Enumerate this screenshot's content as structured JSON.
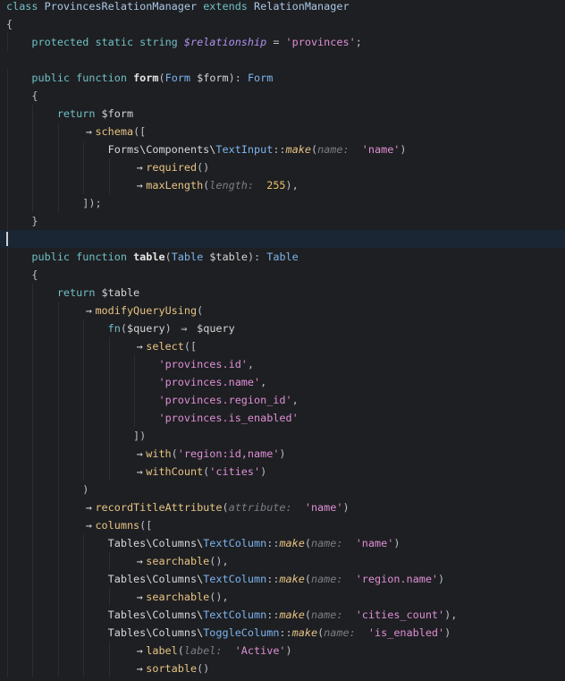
{
  "editor": {
    "current_line": 13,
    "lines": [
      {
        "indent": 0,
        "tokens": [
          [
            "kw",
            "class "
          ],
          [
            "cls",
            "ProvincesRelationManager "
          ],
          [
            "kw",
            "extends "
          ],
          [
            "cls",
            "RelationManager"
          ]
        ]
      },
      {
        "indent": 0,
        "tokens": [
          [
            "punct",
            "{"
          ]
        ]
      },
      {
        "indent": 4,
        "tokens": [
          [
            "kw",
            "protected static string "
          ],
          [
            "ivar",
            "$relationship"
          ],
          [
            "punct",
            " = "
          ],
          [
            "str",
            "'provinces'"
          ],
          [
            "punct",
            ";"
          ]
        ]
      },
      {
        "indent": 0,
        "tokens": []
      },
      {
        "indent": 4,
        "tokens": [
          [
            "kw",
            "public function "
          ],
          [
            "fn",
            "form"
          ],
          [
            "punct",
            "("
          ],
          [
            "type",
            "Form "
          ],
          [
            "var",
            "$form"
          ],
          [
            "punct",
            "): "
          ],
          [
            "type",
            "Form"
          ]
        ]
      },
      {
        "indent": 4,
        "tokens": [
          [
            "punct",
            "{"
          ]
        ]
      },
      {
        "indent": 8,
        "tokens": [
          [
            "kw",
            "return "
          ],
          [
            "var",
            "$form"
          ]
        ]
      },
      {
        "indent": 12,
        "tokens": [
          [
            "op",
            "→"
          ],
          [
            "method",
            "schema"
          ],
          [
            "punct",
            "(["
          ]
        ]
      },
      {
        "indent": 16,
        "tokens": [
          [
            "ns",
            "Forms\\Components\\"
          ],
          [
            "type",
            "TextInput"
          ],
          [
            "punct",
            "::"
          ],
          [
            "static",
            "make"
          ],
          [
            "punct",
            "("
          ],
          [
            "hint",
            "name: "
          ],
          [
            "punct",
            " "
          ],
          [
            "str",
            "'name'"
          ],
          [
            "punct",
            ")"
          ]
        ]
      },
      {
        "indent": 20,
        "tokens": [
          [
            "op",
            "→"
          ],
          [
            "method",
            "required"
          ],
          [
            "punct",
            "()"
          ]
        ]
      },
      {
        "indent": 20,
        "tokens": [
          [
            "op",
            "→"
          ],
          [
            "method",
            "maxLength"
          ],
          [
            "punct",
            "("
          ],
          [
            "hint",
            "length: "
          ],
          [
            "punct",
            " "
          ],
          [
            "num",
            "255"
          ],
          [
            "punct",
            "),"
          ]
        ]
      },
      {
        "indent": 12,
        "tokens": [
          [
            "punct",
            "]);"
          ]
        ]
      },
      {
        "indent": 4,
        "tokens": [
          [
            "punct",
            "}"
          ]
        ]
      },
      {
        "indent": 0,
        "tokens": []
      },
      {
        "indent": 4,
        "tokens": [
          [
            "kw",
            "public function "
          ],
          [
            "fn",
            "table"
          ],
          [
            "punct",
            "("
          ],
          [
            "type",
            "Table "
          ],
          [
            "var",
            "$table"
          ],
          [
            "punct",
            "): "
          ],
          [
            "type",
            "Table"
          ]
        ]
      },
      {
        "indent": 4,
        "tokens": [
          [
            "punct",
            "{"
          ]
        ]
      },
      {
        "indent": 8,
        "tokens": [
          [
            "kw",
            "return "
          ],
          [
            "var",
            "$table"
          ]
        ]
      },
      {
        "indent": 12,
        "tokens": [
          [
            "op",
            "→"
          ],
          [
            "method",
            "modifyQueryUsing"
          ],
          [
            "punct",
            "("
          ]
        ]
      },
      {
        "indent": 16,
        "tokens": [
          [
            "kw",
            "fn"
          ],
          [
            "punct",
            "("
          ],
          [
            "var",
            "$query"
          ],
          [
            "punct",
            ") "
          ],
          [
            "op",
            "⇒"
          ],
          [
            "punct",
            " "
          ],
          [
            "var",
            "$query"
          ]
        ]
      },
      {
        "indent": 20,
        "tokens": [
          [
            "op",
            "→"
          ],
          [
            "method",
            "select"
          ],
          [
            "punct",
            "(["
          ]
        ]
      },
      {
        "indent": 24,
        "tokens": [
          [
            "str",
            "'provinces.id'"
          ],
          [
            "punct",
            ","
          ]
        ]
      },
      {
        "indent": 24,
        "tokens": [
          [
            "str",
            "'provinces.name'"
          ],
          [
            "punct",
            ","
          ]
        ]
      },
      {
        "indent": 24,
        "tokens": [
          [
            "str",
            "'provinces.region_id'"
          ],
          [
            "punct",
            ","
          ]
        ]
      },
      {
        "indent": 24,
        "tokens": [
          [
            "str",
            "'provinces.is_enabled'"
          ]
        ]
      },
      {
        "indent": 20,
        "tokens": [
          [
            "punct",
            "])"
          ]
        ]
      },
      {
        "indent": 20,
        "tokens": [
          [
            "op",
            "→"
          ],
          [
            "method",
            "with"
          ],
          [
            "punct",
            "("
          ],
          [
            "str",
            "'region:id,name'"
          ],
          [
            "punct",
            ")"
          ]
        ]
      },
      {
        "indent": 20,
        "tokens": [
          [
            "op",
            "→"
          ],
          [
            "method",
            "withCount"
          ],
          [
            "punct",
            "("
          ],
          [
            "str",
            "'cities'"
          ],
          [
            "punct",
            ")"
          ]
        ]
      },
      {
        "indent": 12,
        "tokens": [
          [
            "punct",
            ")"
          ]
        ]
      },
      {
        "indent": 12,
        "tokens": [
          [
            "op",
            "→"
          ],
          [
            "method",
            "recordTitleAttribute"
          ],
          [
            "punct",
            "("
          ],
          [
            "hint",
            "attribute: "
          ],
          [
            "punct",
            " "
          ],
          [
            "str",
            "'name'"
          ],
          [
            "punct",
            ")"
          ]
        ]
      },
      {
        "indent": 12,
        "tokens": [
          [
            "op",
            "→"
          ],
          [
            "method",
            "columns"
          ],
          [
            "punct",
            "(["
          ]
        ]
      },
      {
        "indent": 16,
        "tokens": [
          [
            "ns",
            "Tables\\Columns\\"
          ],
          [
            "type",
            "TextColumn"
          ],
          [
            "punct",
            "::"
          ],
          [
            "static",
            "make"
          ],
          [
            "punct",
            "("
          ],
          [
            "hint",
            "name: "
          ],
          [
            "punct",
            " "
          ],
          [
            "str",
            "'name'"
          ],
          [
            "punct",
            ")"
          ]
        ]
      },
      {
        "indent": 20,
        "tokens": [
          [
            "op",
            "→"
          ],
          [
            "method",
            "searchable"
          ],
          [
            "punct",
            "(),"
          ]
        ]
      },
      {
        "indent": 16,
        "tokens": [
          [
            "ns",
            "Tables\\Columns\\"
          ],
          [
            "type",
            "TextColumn"
          ],
          [
            "punct",
            "::"
          ],
          [
            "static",
            "make"
          ],
          [
            "punct",
            "("
          ],
          [
            "hint",
            "name: "
          ],
          [
            "punct",
            " "
          ],
          [
            "str",
            "'region.name'"
          ],
          [
            "punct",
            ")"
          ]
        ]
      },
      {
        "indent": 20,
        "tokens": [
          [
            "op",
            "→"
          ],
          [
            "method",
            "searchable"
          ],
          [
            "punct",
            "(),"
          ]
        ]
      },
      {
        "indent": 16,
        "tokens": [
          [
            "ns",
            "Tables\\Columns\\"
          ],
          [
            "type",
            "TextColumn"
          ],
          [
            "punct",
            "::"
          ],
          [
            "static",
            "make"
          ],
          [
            "punct",
            "("
          ],
          [
            "hint",
            "name: "
          ],
          [
            "punct",
            " "
          ],
          [
            "str",
            "'cities_count'"
          ],
          [
            "punct",
            "),"
          ]
        ]
      },
      {
        "indent": 16,
        "tokens": [
          [
            "ns",
            "Tables\\Columns\\"
          ],
          [
            "type",
            "ToggleColumn"
          ],
          [
            "punct",
            "::"
          ],
          [
            "static",
            "make"
          ],
          [
            "punct",
            "("
          ],
          [
            "hint",
            "name: "
          ],
          [
            "punct",
            " "
          ],
          [
            "str",
            "'is_enabled'"
          ],
          [
            "punct",
            ")"
          ]
        ]
      },
      {
        "indent": 20,
        "tokens": [
          [
            "op",
            "→"
          ],
          [
            "method",
            "label"
          ],
          [
            "punct",
            "("
          ],
          [
            "hint",
            "label: "
          ],
          [
            "punct",
            " "
          ],
          [
            "str",
            "'Active'"
          ],
          [
            "punct",
            ")"
          ]
        ]
      },
      {
        "indent": 20,
        "tokens": [
          [
            "op",
            "→"
          ],
          [
            "method",
            "sortable"
          ],
          [
            "punct",
            "()"
          ]
        ]
      }
    ]
  }
}
